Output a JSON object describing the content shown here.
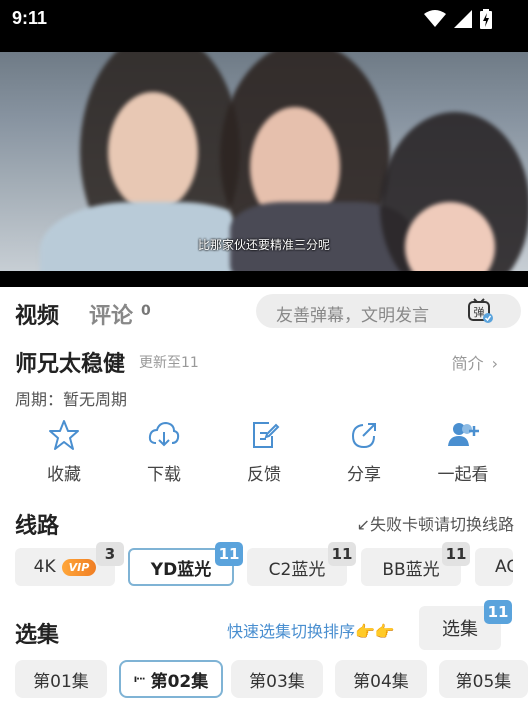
{
  "status_bar": {
    "time": "9:11"
  },
  "video": {
    "subtitle": "比那家伙还要精准三分呢"
  },
  "tabs": [
    {
      "label": "视频"
    },
    {
      "label": "评论",
      "count": "0"
    }
  ],
  "danmu": {
    "placeholder": "友善弹幕，文明发言",
    "icon_text": "弹"
  },
  "show": {
    "title": "师兄太稳健",
    "update": "更新至11",
    "intro": "简介",
    "period": "周期：暂无周期"
  },
  "actions": [
    {
      "label": "收藏",
      "icon": "star-icon"
    },
    {
      "label": "下载",
      "icon": "download-icon"
    },
    {
      "label": "反馈",
      "icon": "feedback-icon"
    },
    {
      "label": "分享",
      "icon": "share-icon"
    },
    {
      "label": "一起看",
      "icon": "add-users-icon"
    }
  ],
  "lines": {
    "title": "线路",
    "hint": "↙失败卡顿请切换线路",
    "items": [
      {
        "label": "4K",
        "vip": "VIP",
        "count": "3"
      },
      {
        "label": "YD蓝光",
        "count": "11",
        "selected": true
      },
      {
        "label": "C2蓝光",
        "count": "11"
      },
      {
        "label": "BB蓝光",
        "count": "11"
      },
      {
        "label": "AC"
      }
    ]
  },
  "episodes": {
    "title": "选集",
    "quick_hint": "快速选集切换排序👉👉",
    "select_label": "选集",
    "select_count": "11",
    "items": [
      {
        "label": "第01集"
      },
      {
        "label": "第02集",
        "selected": true,
        "playing": "ı···"
      },
      {
        "label": "第03集"
      },
      {
        "label": "第04集"
      },
      {
        "label": "第05集"
      }
    ]
  },
  "colors": {
    "accent": "#4a8fd0",
    "badge_blue": "#5aa3dc",
    "selected_border": "#7fb3d5",
    "vip_orange": "#f07e24"
  }
}
